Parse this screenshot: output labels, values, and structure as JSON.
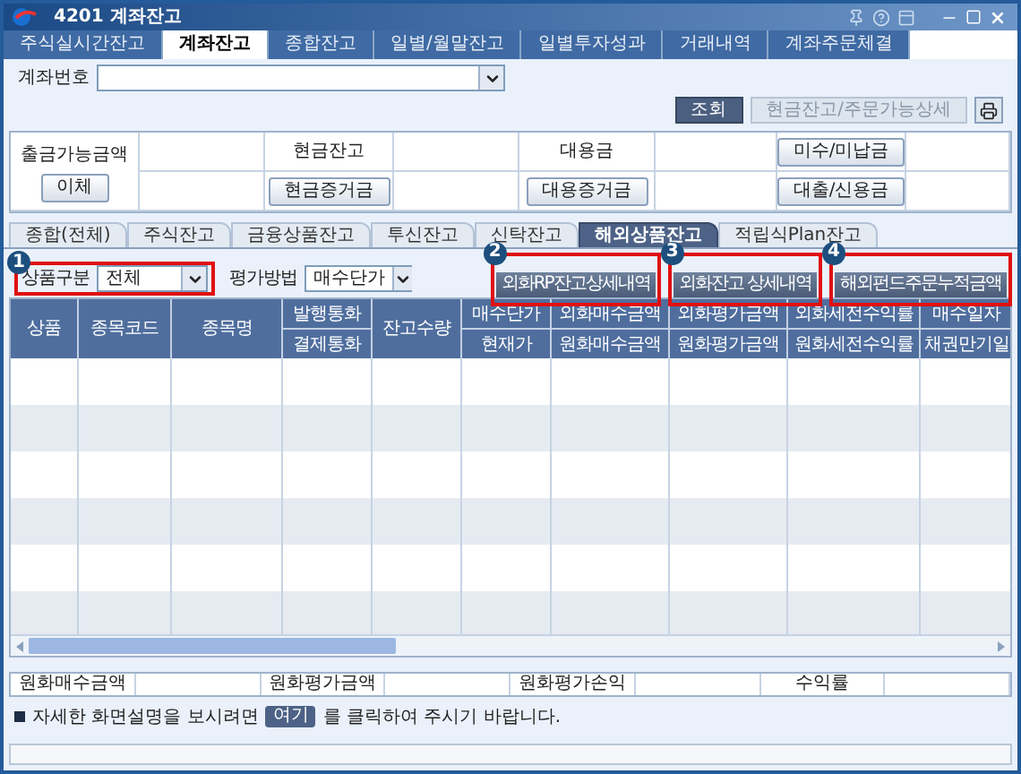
{
  "window": {
    "title": "4201 계좌잔고"
  },
  "tabs": [
    {
      "label": "주식실시간잔고",
      "selected": false
    },
    {
      "label": "계좌잔고",
      "selected": true
    },
    {
      "label": "종합잔고",
      "selected": false
    },
    {
      "label": "일별/월말잔고",
      "selected": false
    },
    {
      "label": "일별투자성과",
      "selected": false
    },
    {
      "label": "거래내역",
      "selected": false
    },
    {
      "label": "계좌주문체결",
      "selected": false
    }
  ],
  "account": {
    "label": "계좌번호"
  },
  "buttons": [
    {
      "label": "조회",
      "disabled": false
    },
    {
      "label": "현금잔고/주문가능상세",
      "disabled": true
    }
  ],
  "summary": [
    {
      "kind": "stacked",
      "label": "출금가능금액",
      "button": "이체"
    },
    {
      "kind": "split",
      "label": "현금잔고",
      "button": "현금증거금"
    },
    {
      "kind": "split",
      "label": "대용금",
      "button": "대용증거금"
    },
    {
      "kind": "buttons",
      "buttons": [
        "미수/미납금",
        "대출/신용금"
      ]
    }
  ],
  "sub_tabs": [
    {
      "label": "종합(전체)",
      "selected": false
    },
    {
      "label": "주식잔고",
      "selected": false
    },
    {
      "label": "금융상품잔고",
      "selected": false
    },
    {
      "label": "투신잔고",
      "selected": false
    },
    {
      "label": "신탁잔고",
      "selected": false
    },
    {
      "label": "해외상품잔고",
      "selected": true
    },
    {
      "label": "적립식Plan잔고",
      "selected": false
    }
  ],
  "filters": [
    {
      "label": "상품구분",
      "value": "전체",
      "marker": "1",
      "highlighted": true
    },
    {
      "label": "평가방법",
      "value": "매수단가",
      "highlighted": false
    }
  ],
  "action_buttons": [
    {
      "label": "외화RP잔고상세내역",
      "marker": "2"
    },
    {
      "label": "외화잔고 상세내역",
      "marker": "3"
    },
    {
      "label": "해외펀드주문누적금액",
      "marker": "4"
    }
  ],
  "grid": {
    "columns": [
      {
        "top": "상품"
      },
      {
        "top": "종목코드"
      },
      {
        "top": "종목명"
      },
      {
        "top": "발행통화",
        "bottom": "결제통화"
      },
      {
        "top": "잔고수량"
      },
      {
        "top": "매수단가",
        "bottom": "현재가"
      },
      {
        "top": "외화매수금액",
        "bottom": "원화매수금액"
      },
      {
        "top": "외화평가금액",
        "bottom": "원화평가금액"
      },
      {
        "top": "외화세전수익률",
        "bottom": "원화세전수익률"
      },
      {
        "top": "매수일자",
        "bottom": "채권만기일"
      }
    ]
  },
  "totals": [
    {
      "label": "원화매수금액"
    },
    {
      "label": "원화평가금액"
    },
    {
      "label": "원화평가손익"
    },
    {
      "label": "수익률"
    }
  ],
  "help": {
    "prefix": "자세한 화면설명을 보시려면",
    "link": "여기",
    "suffix": "를 클릭하여 주시기 바랍니다."
  }
}
